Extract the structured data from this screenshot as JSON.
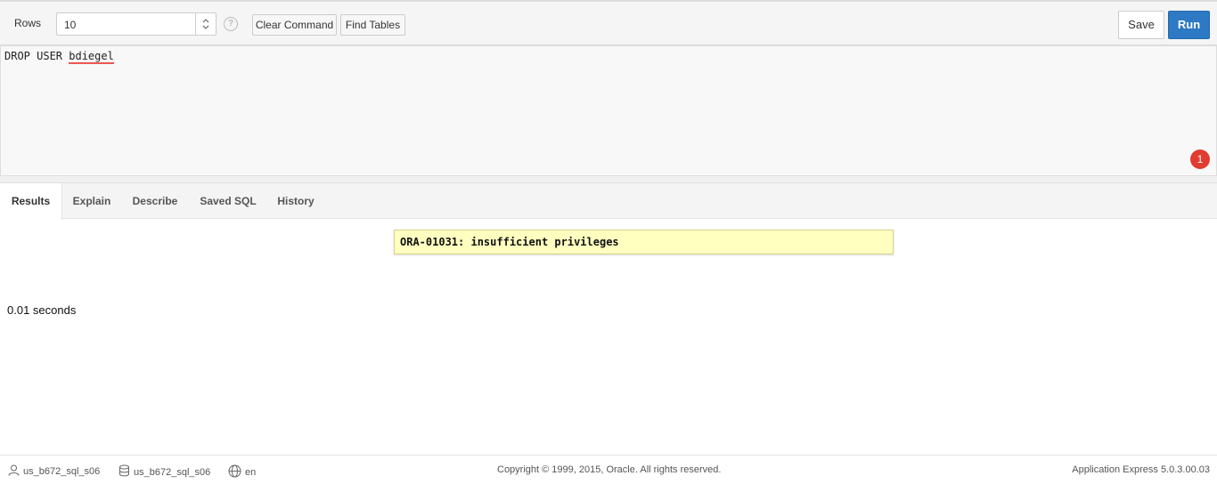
{
  "toolbar": {
    "rows_label": "Rows",
    "rows_value": "10",
    "help": "?",
    "clear_command": "Clear Command",
    "find_tables": "Find Tables",
    "save": "Save",
    "run": "Run"
  },
  "editor": {
    "sql_prefix": "DROP USER ",
    "sql_word": "bdiegel",
    "error_count": "1"
  },
  "tabs": [
    "Results",
    "Explain",
    "Describe",
    "Saved SQL",
    "History"
  ],
  "results": {
    "error_message": "ORA-01031: insufficient privileges",
    "elapsed": "0.01 seconds"
  },
  "footer": {
    "user": "us_b672_sql_s06",
    "schema": "us_b672_sql_s06",
    "language": "en",
    "copyright": "Copyright © 1999, 2015, Oracle. All rights reserved.",
    "version": "Application Express 5.0.3.00.03"
  }
}
